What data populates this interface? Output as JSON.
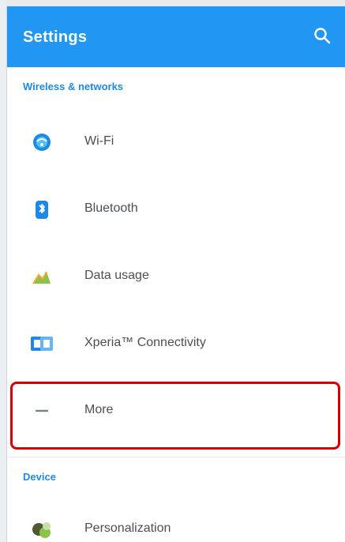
{
  "appbar": {
    "title": "Settings",
    "search_icon": "search-icon",
    "color": "#2196f3"
  },
  "sections": [
    {
      "header": "Wireless & networks",
      "items": [
        {
          "label": "Wi-Fi",
          "icon": "wifi-icon"
        },
        {
          "label": "Bluetooth",
          "icon": "bluetooth-icon"
        },
        {
          "label": "Data usage",
          "icon": "data-usage-icon"
        },
        {
          "label": "Xperia™ Connectivity",
          "icon": "xperia-connectivity-icon"
        },
        {
          "label": "More",
          "icon": "more-icon"
        }
      ]
    },
    {
      "header": "Device",
      "items": [
        {
          "label": "Personalization",
          "icon": "personalization-icon"
        }
      ]
    }
  ],
  "highlight_color": "#d50000"
}
